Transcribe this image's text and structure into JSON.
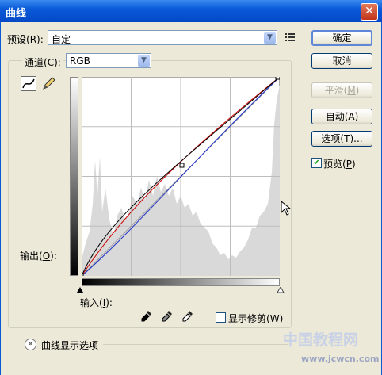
{
  "window": {
    "title": "曲线",
    "close_glyph": "✕"
  },
  "preset": {
    "label": "预设(",
    "key": "R",
    "label_end": "):",
    "value": "自定",
    "menu_icon": "list-options-icon"
  },
  "channel": {
    "label": "通道(",
    "key": "C",
    "label_end": "):",
    "value": "RGB"
  },
  "buttons": {
    "ok": "确定",
    "cancel": "取消",
    "smooth_label": "平滑(",
    "smooth_key": "M",
    "smooth_end": ")",
    "auto_label": "自动(",
    "auto_key": "A",
    "auto_end": ")",
    "options_label": "选项(",
    "options_key": "T",
    "options_end": ")..."
  },
  "preview": {
    "label": "预览(",
    "key": "P",
    "label_end": ")",
    "checked": true,
    "check_glyph": "✔"
  },
  "curve_area": {
    "output_label": "输出(",
    "output_key": "O",
    "output_end": "):",
    "input_label": "输入(",
    "input_key": "I",
    "input_end": "):",
    "show_clipping_label": "显示修剪(",
    "show_clipping_key": "W",
    "show_clipping_end": ")",
    "show_clipping_checked": false
  },
  "display_options": {
    "label": "曲线显示选项",
    "expand_glyph": "»"
  },
  "colors": {
    "title_bar": "#0a5ad8",
    "curve_rgb": "#000000",
    "curve_red": "#cc0000",
    "curve_blue": "#2233cc",
    "histogram": "#d6d6d6"
  },
  "watermark": {
    "line1": "中国教程网",
    "line2": "www.jcwcn.com"
  }
}
